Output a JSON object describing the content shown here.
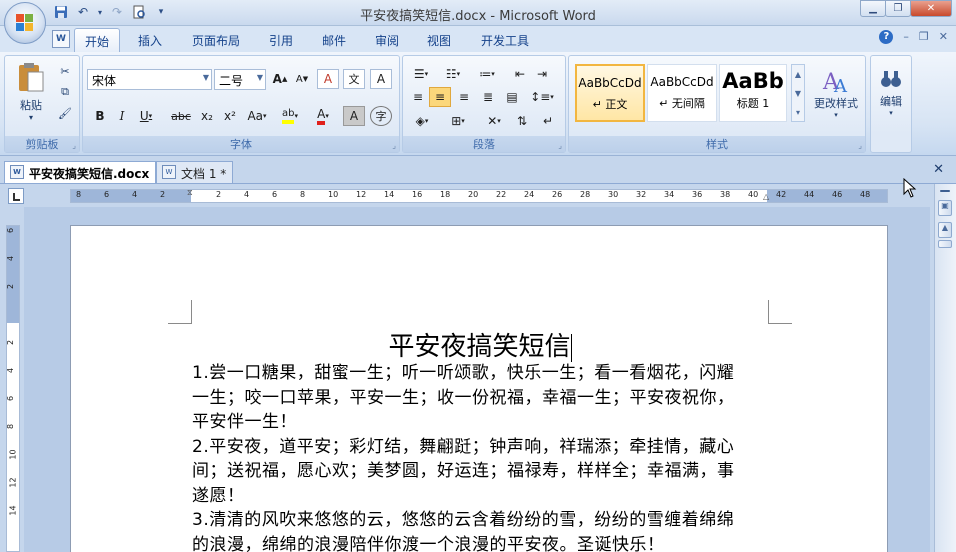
{
  "window": {
    "title": "平安夜搞笑短信.docx - Microsoft Word",
    "office_button_icon": "office-logo-icon",
    "qat": [
      "save-icon",
      "undo-icon",
      "redo-icon",
      "print-preview-icon",
      "customize-qat-icon"
    ],
    "controls": [
      "minimize-icon",
      "restore-icon",
      "close-icon"
    ]
  },
  "ribbon": {
    "tabs": [
      {
        "label": "开始",
        "active": true
      },
      {
        "label": "插入"
      },
      {
        "label": "页面布局"
      },
      {
        "label": "引用"
      },
      {
        "label": "邮件"
      },
      {
        "label": "审阅"
      },
      {
        "label": "视图"
      },
      {
        "label": "开发工具"
      }
    ],
    "groups": {
      "clipboard": {
        "label": "剪贴板",
        "paste": "粘贴"
      },
      "font": {
        "label": "字体",
        "font_name": "宋体",
        "font_size": "二号",
        "bold": "B",
        "italic": "I",
        "underline": "U",
        "strike": "abc",
        "subscript": "x₂",
        "superscript": "x²",
        "change_case": "Aa",
        "highlight": "ab",
        "font_color": "A",
        "char_shading": "A",
        "enclose": "字",
        "grow": "A",
        "shrink": "A",
        "clear_format": "A",
        "phonetic": "文"
      },
      "paragraph": {
        "label": "段落"
      },
      "styles": {
        "label": "样式",
        "items": [
          {
            "sample": "AaBbCcDd",
            "name": "↵ 正文",
            "selected": true
          },
          {
            "sample": "AaBbCcDd",
            "name": "↵ 无间隔"
          },
          {
            "sample": "AaBb",
            "name": "标题 1"
          }
        ],
        "change_styles": "更改样式"
      },
      "editing": {
        "label": "编辑"
      }
    }
  },
  "doc_tabs": [
    {
      "label": "平安夜搞笑短信.docx",
      "active": true
    },
    {
      "label": "文档 1 *"
    }
  ],
  "ruler": {
    "ticks": [
      "8",
      "6",
      "4",
      "2",
      "",
      "2",
      "4",
      "6",
      "8",
      "10",
      "12",
      "14",
      "16",
      "18",
      "20",
      "22",
      "24",
      "26",
      "28",
      "30",
      "32",
      "34",
      "36",
      "38",
      "40",
      "42",
      "44",
      "46",
      "48"
    ],
    "vticks": [
      "6",
      "4",
      "2",
      "",
      "2",
      "4",
      "6",
      "8",
      "10",
      "12",
      "14"
    ]
  },
  "document": {
    "title": "平安夜搞笑短信",
    "lines": [
      "1.尝一口糖果，甜蜜一生；听一听颂歌，快乐一生；看一看烟花，闪耀",
      "一生；咬一口苹果，平安一生；收一份祝福，幸福一生；平安夜祝你，",
      "平安伴一生！",
      "2.平安夜，道平安；彩灯结，舞翩跹；钟声响，祥瑞添；牵挂情，藏心",
      "间；送祝福，愿心欢；美梦圆，好运连；福禄寿，样样全；幸福满，事",
      "遂愿！",
      "3.清清的风吹来悠悠的云，悠悠的云含着纷纷的雪，纷纷的雪缠着绵绵",
      "的浪漫，绵绵的浪漫陪伴你渡一个浪漫的平安夜。圣诞快乐！"
    ]
  }
}
